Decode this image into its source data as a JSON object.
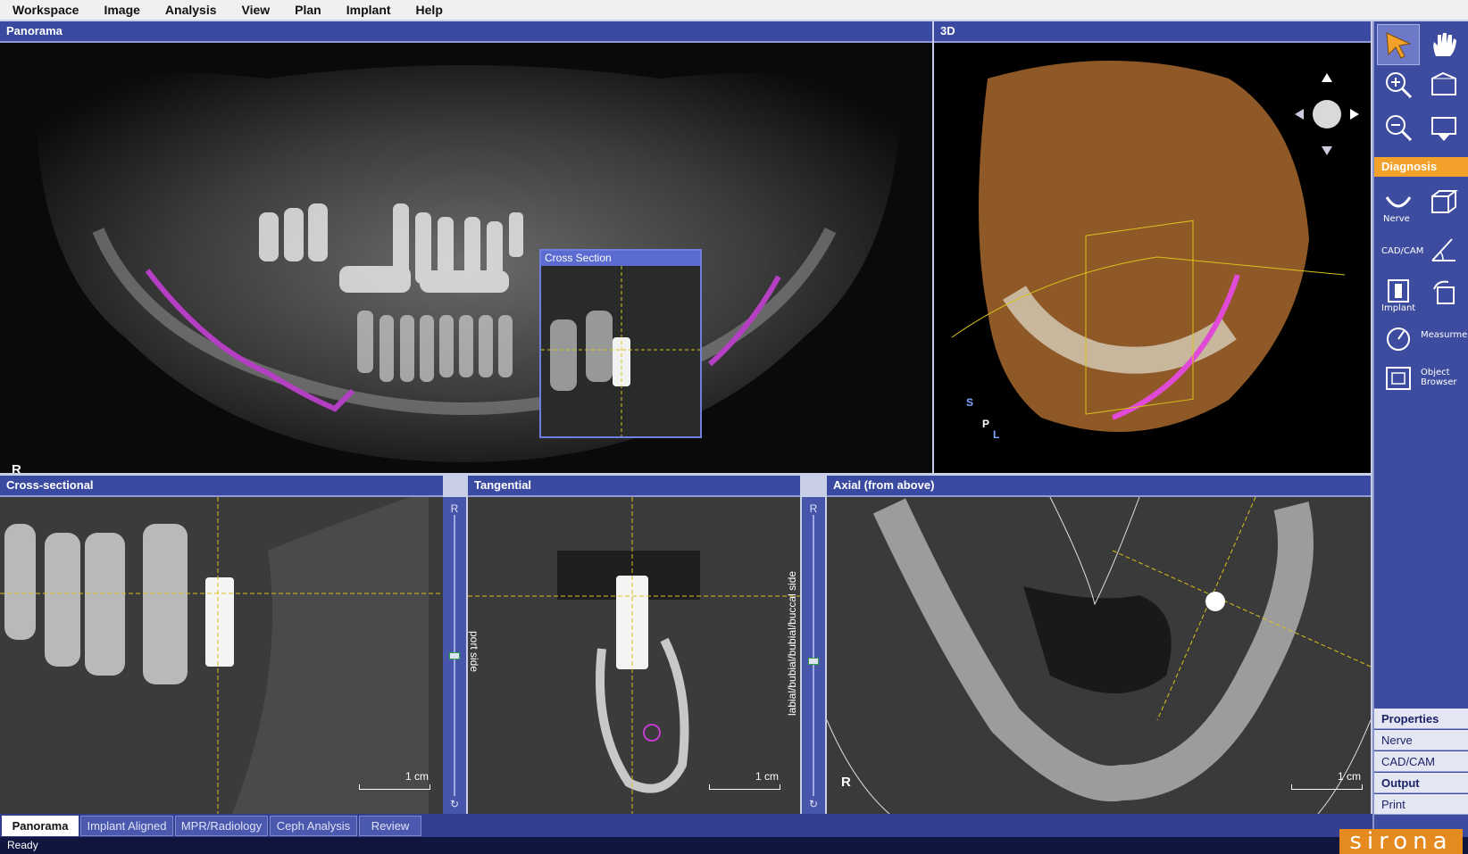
{
  "menu": [
    "Workspace",
    "Image",
    "Analysis",
    "View",
    "Plan",
    "Implant",
    "Help"
  ],
  "panes": {
    "panorama": {
      "title": "Panorama",
      "side_marker": "R",
      "inset_title": "Cross Section"
    },
    "view3d": {
      "title": "3D",
      "axis_s": "S",
      "axis_p": "P",
      "axis_l": "L"
    },
    "cross": {
      "title": "Cross-sectional",
      "scale": "1 cm",
      "slider_top": "R",
      "knob_fraction": 0.5
    },
    "tangential": {
      "title": "Tangential",
      "scale": "1 cm",
      "side_left": "port side",
      "side_right": "labial/bubial/bubial/buccal side",
      "slider_top": "R",
      "knob_fraction": 0.52
    },
    "axial": {
      "title": "Axial (from above)",
      "scale": "1 cm",
      "side_marker": "R"
    }
  },
  "toolpanel": {
    "diagnosis_label": "Diagnosis",
    "tools": {
      "nerve": "Nerve",
      "cadcam": "CAD/CAM",
      "implant": "Implant",
      "measurement": "Measurment",
      "object_browser_1": "Object",
      "object_browser_2": "Browser"
    },
    "bottom_buttons": [
      "Properties",
      "Nerve",
      "CAD/CAM",
      "Output",
      "Print"
    ]
  },
  "tabs": [
    "Panorama",
    "Implant Aligned",
    "MPR/Radiology",
    "Ceph Analysis",
    "Review"
  ],
  "active_tab": "Panorama",
  "status": "Ready",
  "brand": "sirona",
  "colors": {
    "title_bar": "#3a4aa0",
    "accent_orange": "#f2a12b",
    "nerve_canal": "#c23bd0",
    "guide_line": "#d8c21a"
  }
}
